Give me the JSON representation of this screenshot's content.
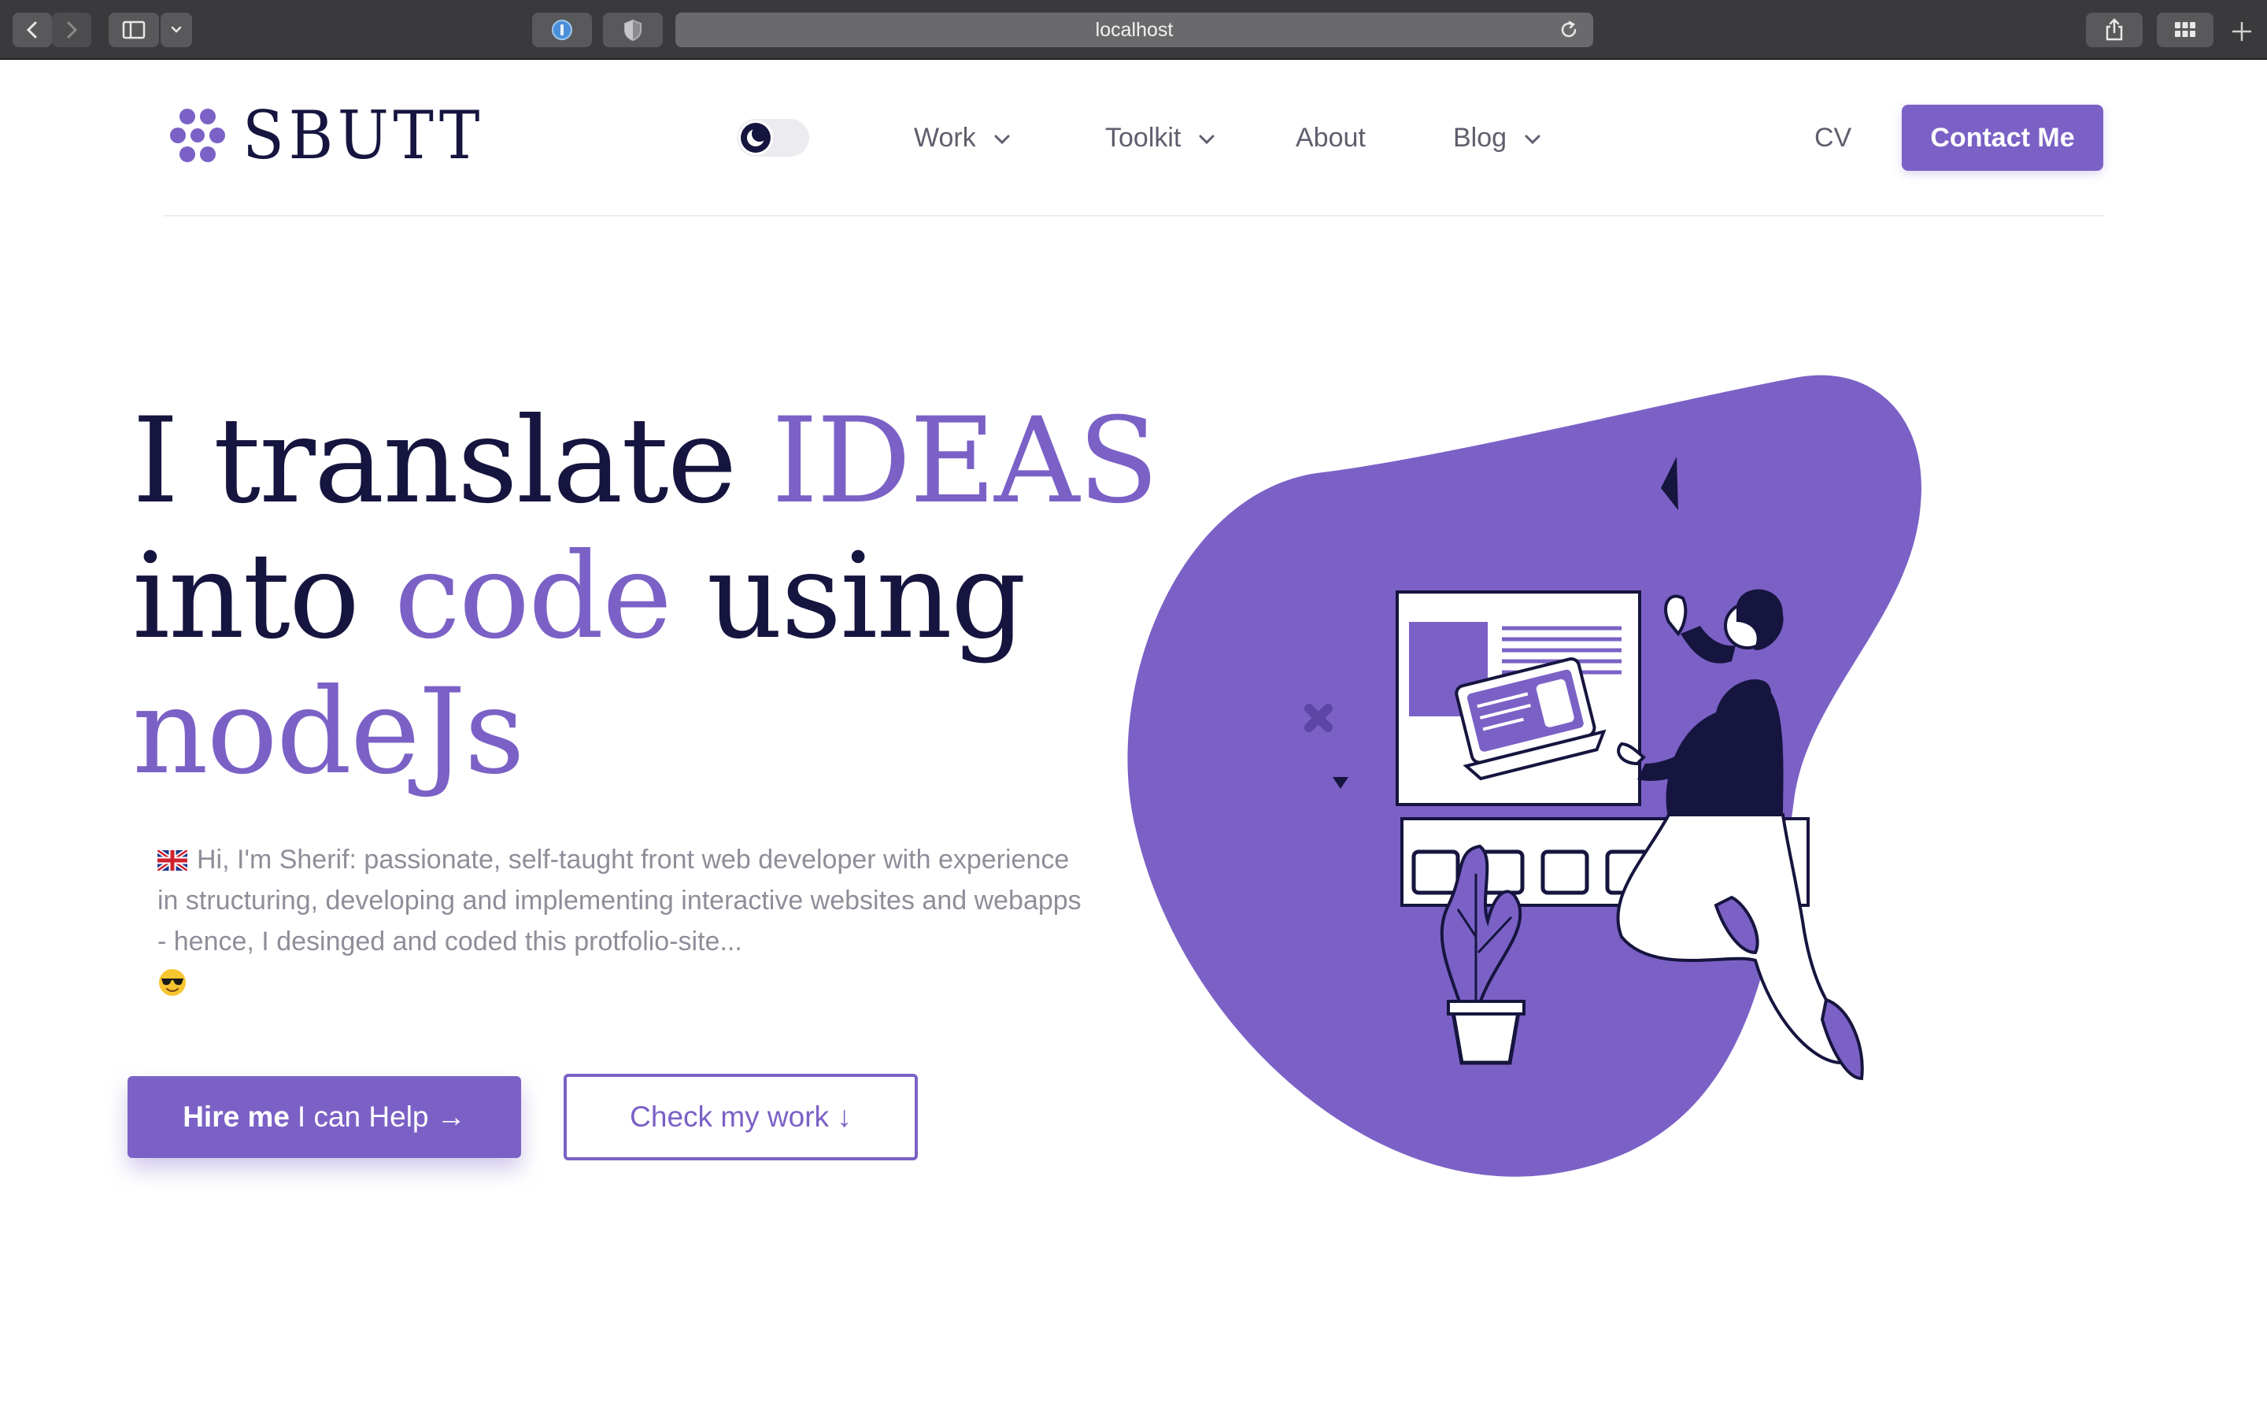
{
  "browser": {
    "url": "localhost"
  },
  "nav": {
    "logo_text": "SBUTT",
    "items": [
      {
        "label": "Work"
      },
      {
        "label": "Toolkit"
      },
      {
        "label": "About"
      },
      {
        "label": "Blog"
      },
      {
        "label": "CV"
      }
    ],
    "contact_label": "Contact Me"
  },
  "hero": {
    "headline": {
      "l1_a": "I translate ",
      "l1_b": "IDEAS",
      "l2_a": "into ",
      "l2_b": "code",
      "l2_c": " using",
      "l3": "nodeJs"
    },
    "intro": "Hi, I'm Sherif: passionate, self-taught front web developer with experience in structuring, developing and implementing interactive websites and webapps - hence, I desinged and coded this protfolio-site...",
    "hire_bold": "Hire me",
    "hire_rest": "I can Help →",
    "check_label": "Check my work ↓"
  },
  "colors": {
    "accent": "#7b61c6",
    "navy": "#16153f",
    "muted_text": "#8e8e9a"
  },
  "icons": [
    "back-icon",
    "forward-icon",
    "sidebar-icon",
    "chevron-down-icon",
    "password-icon",
    "shield-icon",
    "reload-icon",
    "share-icon",
    "grid-icon",
    "plus-icon",
    "moon-icon",
    "uk-flag-icon",
    "sunglasses-emoji-icon"
  ]
}
